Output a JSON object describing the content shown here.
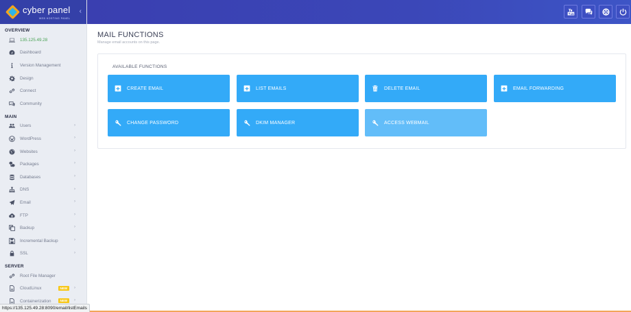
{
  "brand": {
    "name": "cyber panel",
    "tagline": "WEB HOSTING PANEL",
    "collapse_glyph": "‹"
  },
  "sidebar": {
    "sections": [
      {
        "title": "OVERVIEW"
      },
      {
        "title": "MAIN"
      },
      {
        "title": "SERVER"
      }
    ],
    "overview": [
      {
        "label": "135.125.49.28",
        "icon": "laptop-icon"
      },
      {
        "label": "Dashboard",
        "icon": "dashboard-icon"
      },
      {
        "label": "Version Management",
        "icon": "info-icon"
      },
      {
        "label": "Design",
        "icon": "gear-icon"
      },
      {
        "label": "Connect",
        "icon": "link-icon"
      },
      {
        "label": "Community",
        "icon": "comments-icon"
      }
    ],
    "main": [
      {
        "label": "Users",
        "icon": "users-icon"
      },
      {
        "label": "WordPress",
        "icon": "wordpress-icon"
      },
      {
        "label": "Websites",
        "icon": "globe-icon"
      },
      {
        "label": "Packages",
        "icon": "cubes-icon"
      },
      {
        "label": "Databases",
        "icon": "database-icon"
      },
      {
        "label": "DNS",
        "icon": "sitemap-icon"
      },
      {
        "label": "Email",
        "icon": "paper-plane-icon"
      },
      {
        "label": "FTP",
        "icon": "cloud-upload-icon"
      },
      {
        "label": "Backup",
        "icon": "copy-icon"
      },
      {
        "label": "Incremental Backup",
        "icon": "save-icon"
      },
      {
        "label": "SSL",
        "icon": "lock-icon"
      }
    ],
    "server": [
      {
        "label": "Root File Manager",
        "icon": "link-icon"
      },
      {
        "label": "CloudLinux",
        "icon": "file-icon",
        "badge": "NEW"
      },
      {
        "label": "Containerization",
        "icon": "file-icon",
        "badge": "NEW"
      }
    ],
    "chevron": "›"
  },
  "topbar": {
    "buttons": [
      {
        "name": "youtube-button",
        "icon": "youtube-icon"
      },
      {
        "name": "chat-button",
        "icon": "comments-icon"
      },
      {
        "name": "support-button",
        "icon": "life-ring-icon"
      },
      {
        "name": "power-button",
        "icon": "power-icon"
      }
    ]
  },
  "page": {
    "title": "MAIL FUNCTIONS",
    "description": "Manage email accounts on this page."
  },
  "panel": {
    "title": "AVAILABLE FUNCTIONS",
    "functions": [
      {
        "label": "CREATE EMAIL",
        "icon": "plus-square-icon"
      },
      {
        "label": "LIST EMAILS",
        "icon": "plus-square-icon"
      },
      {
        "label": "DELETE EMAIL",
        "icon": "trash-icon"
      },
      {
        "label": "EMAIL FORWARDING",
        "icon": "plus-square-icon"
      },
      {
        "label": "CHANGE PASSWORD",
        "icon": "key-icon"
      },
      {
        "label": "DKIM MANAGER",
        "icon": "key-icon"
      },
      {
        "label": "ACCESS WEBMAIL",
        "icon": "key-icon"
      }
    ]
  },
  "statusbar": {
    "url": "https://135.125.49.28:8090/email/listEmails"
  },
  "colors": {
    "accent": "#33aaf8",
    "topbar": "#3a3fb0",
    "badge": "#f7c81b",
    "ip_text": "#4aa355"
  }
}
